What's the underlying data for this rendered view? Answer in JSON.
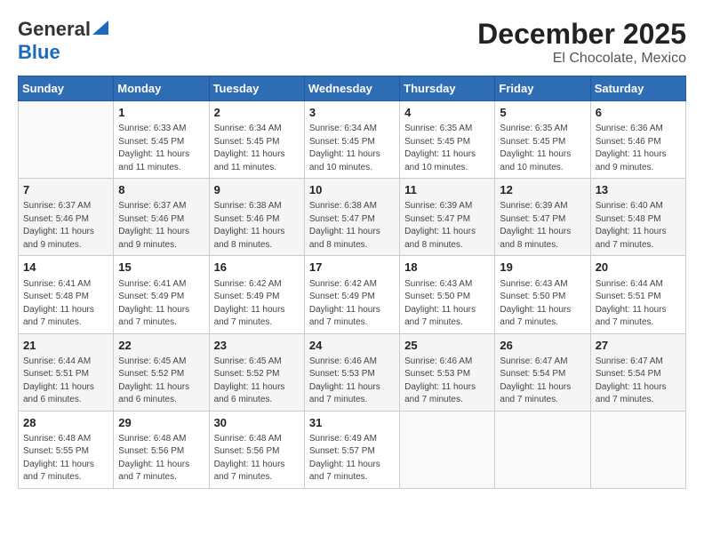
{
  "logo": {
    "general": "General",
    "blue": "Blue"
  },
  "title": "December 2025",
  "subtitle": "El Chocolate, Mexico",
  "days_header": [
    "Sunday",
    "Monday",
    "Tuesday",
    "Wednesday",
    "Thursday",
    "Friday",
    "Saturday"
  ],
  "weeks": [
    [
      {
        "day": "",
        "info": ""
      },
      {
        "day": "1",
        "info": "Sunrise: 6:33 AM\nSunset: 5:45 PM\nDaylight: 11 hours\nand 11 minutes."
      },
      {
        "day": "2",
        "info": "Sunrise: 6:34 AM\nSunset: 5:45 PM\nDaylight: 11 hours\nand 11 minutes."
      },
      {
        "day": "3",
        "info": "Sunrise: 6:34 AM\nSunset: 5:45 PM\nDaylight: 11 hours\nand 10 minutes."
      },
      {
        "day": "4",
        "info": "Sunrise: 6:35 AM\nSunset: 5:45 PM\nDaylight: 11 hours\nand 10 minutes."
      },
      {
        "day": "5",
        "info": "Sunrise: 6:35 AM\nSunset: 5:45 PM\nDaylight: 11 hours\nand 10 minutes."
      },
      {
        "day": "6",
        "info": "Sunrise: 6:36 AM\nSunset: 5:46 PM\nDaylight: 11 hours\nand 9 minutes."
      }
    ],
    [
      {
        "day": "7",
        "info": "Sunrise: 6:37 AM\nSunset: 5:46 PM\nDaylight: 11 hours\nand 9 minutes."
      },
      {
        "day": "8",
        "info": "Sunrise: 6:37 AM\nSunset: 5:46 PM\nDaylight: 11 hours\nand 9 minutes."
      },
      {
        "day": "9",
        "info": "Sunrise: 6:38 AM\nSunset: 5:46 PM\nDaylight: 11 hours\nand 8 minutes."
      },
      {
        "day": "10",
        "info": "Sunrise: 6:38 AM\nSunset: 5:47 PM\nDaylight: 11 hours\nand 8 minutes."
      },
      {
        "day": "11",
        "info": "Sunrise: 6:39 AM\nSunset: 5:47 PM\nDaylight: 11 hours\nand 8 minutes."
      },
      {
        "day": "12",
        "info": "Sunrise: 6:39 AM\nSunset: 5:47 PM\nDaylight: 11 hours\nand 8 minutes."
      },
      {
        "day": "13",
        "info": "Sunrise: 6:40 AM\nSunset: 5:48 PM\nDaylight: 11 hours\nand 7 minutes."
      }
    ],
    [
      {
        "day": "14",
        "info": "Sunrise: 6:41 AM\nSunset: 5:48 PM\nDaylight: 11 hours\nand 7 minutes."
      },
      {
        "day": "15",
        "info": "Sunrise: 6:41 AM\nSunset: 5:49 PM\nDaylight: 11 hours\nand 7 minutes."
      },
      {
        "day": "16",
        "info": "Sunrise: 6:42 AM\nSunset: 5:49 PM\nDaylight: 11 hours\nand 7 minutes."
      },
      {
        "day": "17",
        "info": "Sunrise: 6:42 AM\nSunset: 5:49 PM\nDaylight: 11 hours\nand 7 minutes."
      },
      {
        "day": "18",
        "info": "Sunrise: 6:43 AM\nSunset: 5:50 PM\nDaylight: 11 hours\nand 7 minutes."
      },
      {
        "day": "19",
        "info": "Sunrise: 6:43 AM\nSunset: 5:50 PM\nDaylight: 11 hours\nand 7 minutes."
      },
      {
        "day": "20",
        "info": "Sunrise: 6:44 AM\nSunset: 5:51 PM\nDaylight: 11 hours\nand 7 minutes."
      }
    ],
    [
      {
        "day": "21",
        "info": "Sunrise: 6:44 AM\nSunset: 5:51 PM\nDaylight: 11 hours\nand 6 minutes."
      },
      {
        "day": "22",
        "info": "Sunrise: 6:45 AM\nSunset: 5:52 PM\nDaylight: 11 hours\nand 6 minutes."
      },
      {
        "day": "23",
        "info": "Sunrise: 6:45 AM\nSunset: 5:52 PM\nDaylight: 11 hours\nand 6 minutes."
      },
      {
        "day": "24",
        "info": "Sunrise: 6:46 AM\nSunset: 5:53 PM\nDaylight: 11 hours\nand 7 minutes."
      },
      {
        "day": "25",
        "info": "Sunrise: 6:46 AM\nSunset: 5:53 PM\nDaylight: 11 hours\nand 7 minutes."
      },
      {
        "day": "26",
        "info": "Sunrise: 6:47 AM\nSunset: 5:54 PM\nDaylight: 11 hours\nand 7 minutes."
      },
      {
        "day": "27",
        "info": "Sunrise: 6:47 AM\nSunset: 5:54 PM\nDaylight: 11 hours\nand 7 minutes."
      }
    ],
    [
      {
        "day": "28",
        "info": "Sunrise: 6:48 AM\nSunset: 5:55 PM\nDaylight: 11 hours\nand 7 minutes."
      },
      {
        "day": "29",
        "info": "Sunrise: 6:48 AM\nSunset: 5:56 PM\nDaylight: 11 hours\nand 7 minutes."
      },
      {
        "day": "30",
        "info": "Sunrise: 6:48 AM\nSunset: 5:56 PM\nDaylight: 11 hours\nand 7 minutes."
      },
      {
        "day": "31",
        "info": "Sunrise: 6:49 AM\nSunset: 5:57 PM\nDaylight: 11 hours\nand 7 minutes."
      },
      {
        "day": "",
        "info": ""
      },
      {
        "day": "",
        "info": ""
      },
      {
        "day": "",
        "info": ""
      }
    ]
  ]
}
